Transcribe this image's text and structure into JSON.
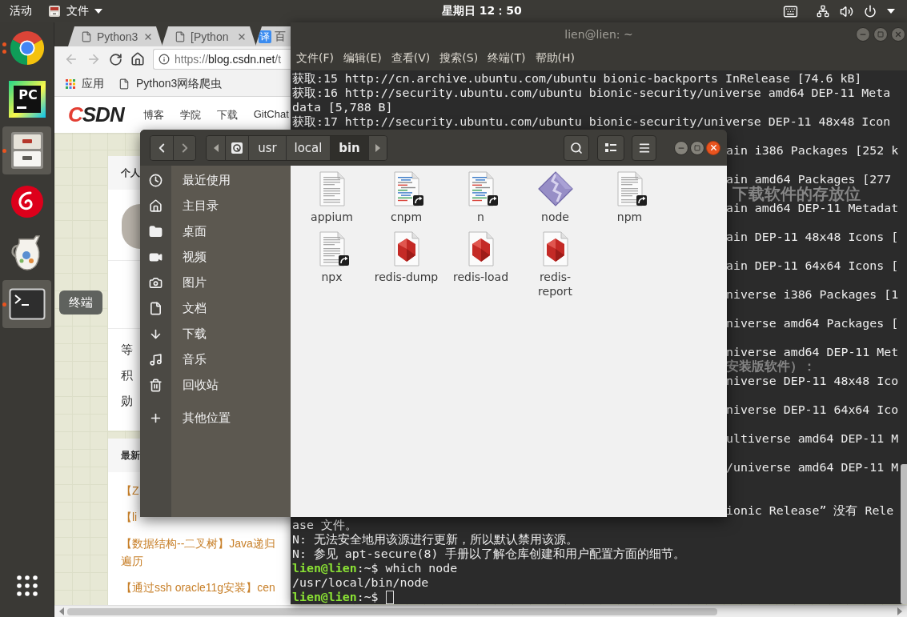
{
  "top_bar": {
    "activities": "活动",
    "app_menu": "文件",
    "clock": "星期日 12：50"
  },
  "dock": {
    "items": [
      {
        "kind": "browser",
        "running": true,
        "multiple_windows": true,
        "highlighted": false
      },
      {
        "kind": "ide",
        "glyph": "PC",
        "running": false,
        "multiple_windows": false,
        "highlighted": false
      },
      {
        "kind": "files",
        "running": true,
        "multiple_windows": false,
        "highlighted": true
      },
      {
        "kind": "music",
        "running": false,
        "multiple_windows": false,
        "highlighted": false
      },
      {
        "kind": "jug",
        "running": false,
        "multiple_windows": false,
        "highlighted": false
      },
      {
        "kind": "terminal",
        "running": true,
        "multiple_windows": false,
        "highlighted": true
      }
    ],
    "tooltip": "终端"
  },
  "browser": {
    "tabs": [
      {
        "title": "Python3",
        "selected": false
      },
      {
        "title": "[Python",
        "selected": false
      },
      {
        "favicon_text": "译",
        "title": "百",
        "selected": false
      }
    ],
    "back_enabled": false,
    "forward_enabled": false,
    "url": {
      "scheme": "https://",
      "host": "blog.csdn.net",
      "path": "/t"
    },
    "bookmarks": [
      {
        "kind": "apps",
        "label": "应用"
      },
      {
        "kind": "page",
        "label": "Python3网络爬虫"
      }
    ],
    "site": {
      "logo": "CSDN",
      "nav": [
        "博客",
        "学院",
        "下载",
        "GitChat"
      ]
    },
    "profile_card": {
      "title": "个人",
      "stats": [
        "等",
        "积",
        "勋"
      ]
    },
    "recent_card": {
      "title": "最新",
      "links": [
        {
          "text": "【Z"
        },
        {
          "text": "【li"
        },
        {
          "text": "【数据结构--二叉树】Java递归",
          "continued": "遍历"
        },
        {
          "text": "【通过ssh oracle11g安装】cen"
        }
      ]
    }
  },
  "terminal": {
    "title": "lien@lien: ~",
    "menu": [
      "文件(F)",
      "编辑(E)",
      "查看(V)",
      "搜索(S)",
      "终端(T)",
      "帮助(H)"
    ],
    "lines": [
      {
        "kind": "output",
        "text": "获取:15 http://cn.archive.ubuntu.com/ubuntu bionic-backports InRelease [74.6 kB]"
      },
      {
        "kind": "output",
        "text": "获取:16 http://security.ubuntu.com/ubuntu bionic-security/universe amd64 DEP-11 Meta"
      },
      {
        "kind": "output",
        "text": "data [5,788 B]"
      },
      {
        "kind": "output",
        "text": "获取:17 http://security.ubuntu.com/ubuntu bionic-security/universe DEP-11 48x48 Icon"
      },
      {
        "kind": "blank"
      },
      {
        "kind": "side",
        "text": "ain i386 Packages [252 k"
      },
      {
        "kind": "blank"
      },
      {
        "kind": "side",
        "text": "ain amd64 Packages [277"
      },
      {
        "kind": "ghost_heading",
        "text": "下载软件的存放位"
      },
      {
        "kind": "side",
        "text": "ain amd64 DEP-11 Metadat"
      },
      {
        "kind": "blank"
      },
      {
        "kind": "side",
        "text": "ain DEP-11 48x48 Icons ["
      },
      {
        "kind": "blank"
      },
      {
        "kind": "side",
        "text": "ain DEP-11 64x64 Icons ["
      },
      {
        "kind": "blank"
      },
      {
        "kind": "side",
        "text": "niverse i386 Packages [1"
      },
      {
        "kind": "blank"
      },
      {
        "kind": "side",
        "text": "niverse amd64 Packages ["
      },
      {
        "kind": "blank"
      },
      {
        "kind": "side",
        "text": "niverse amd64 DEP-11 Met"
      },
      {
        "kind": "ghost_text",
        "text": "安装版软件）："
      },
      {
        "kind": "side",
        "text": "niverse DEP-11 48x48 Ico"
      },
      {
        "kind": "blank"
      },
      {
        "kind": "side",
        "text": "niverse DEP-11 64x64 Ico"
      },
      {
        "kind": "blank"
      },
      {
        "kind": "side",
        "text": "ultiverse amd64 DEP-11 M"
      },
      {
        "kind": "blank"
      },
      {
        "kind": "side",
        "text": "/universe amd64 DEP-11 M"
      },
      {
        "kind": "blank"
      },
      {
        "kind": "blank"
      },
      {
        "kind": "side",
        "text": "ionic Release” 没有 Rele"
      },
      {
        "kind": "output",
        "text": "ase 文件。"
      },
      {
        "kind": "output",
        "text": "N: 无法安全地用该源进行更新，所以默认禁用该源。"
      },
      {
        "kind": "output",
        "text": "N: 参见 apt-secure(8) 手册以了解仓库创建和用户配置方面的细节。"
      },
      {
        "kind": "prompt",
        "user": "lien@lien",
        "path": ":~$",
        "command": "which node",
        "cursor": false
      },
      {
        "kind": "output",
        "text": "/usr/local/bin/node"
      },
      {
        "kind": "prompt",
        "user": "lien@lien",
        "path": ":~$",
        "cursor": true
      }
    ]
  },
  "file_manager": {
    "path": [
      {
        "kind": "root",
        "selected": false
      },
      {
        "kind": "folder",
        "label": "usr",
        "selected": false
      },
      {
        "kind": "folder",
        "label": "local",
        "selected": false
      },
      {
        "kind": "folder",
        "label": "bin",
        "selected": true
      }
    ],
    "sidebar": [
      {
        "label": "最近使用",
        "selected": false
      },
      {
        "label": "主目录",
        "selected": false
      },
      {
        "label": "桌面",
        "selected": false
      },
      {
        "label": "视频",
        "selected": false
      },
      {
        "label": "图片",
        "selected": false
      },
      {
        "label": "文档",
        "selected": false
      },
      {
        "label": "下载",
        "selected": false
      },
      {
        "label": "音乐",
        "selected": false
      },
      {
        "label": "回收站",
        "selected": false
      }
    ],
    "other_locations": {
      "label": "其他位置",
      "selected": false
    },
    "files": [
      {
        "name": "appium",
        "kind": "text",
        "symlink": false,
        "selected": false
      },
      {
        "name": "cnpm",
        "kind": "script",
        "symlink": true,
        "selected": false
      },
      {
        "name": "n",
        "kind": "script",
        "symlink": true,
        "selected": false
      },
      {
        "name": "node",
        "kind": "binary",
        "symlink": false,
        "selected": false
      },
      {
        "name": "npm",
        "kind": "text",
        "symlink": true,
        "selected": false
      },
      {
        "name": "npx",
        "kind": "text",
        "symlink": true,
        "selected": false
      },
      {
        "name": "redis-dump",
        "kind": "ruby",
        "symlink": false,
        "selected": false
      },
      {
        "name": "redis-load",
        "kind": "ruby",
        "symlink": false,
        "selected": false
      },
      {
        "name": "redis-report",
        "kind": "ruby",
        "symlink": false,
        "selected": false
      }
    ]
  }
}
